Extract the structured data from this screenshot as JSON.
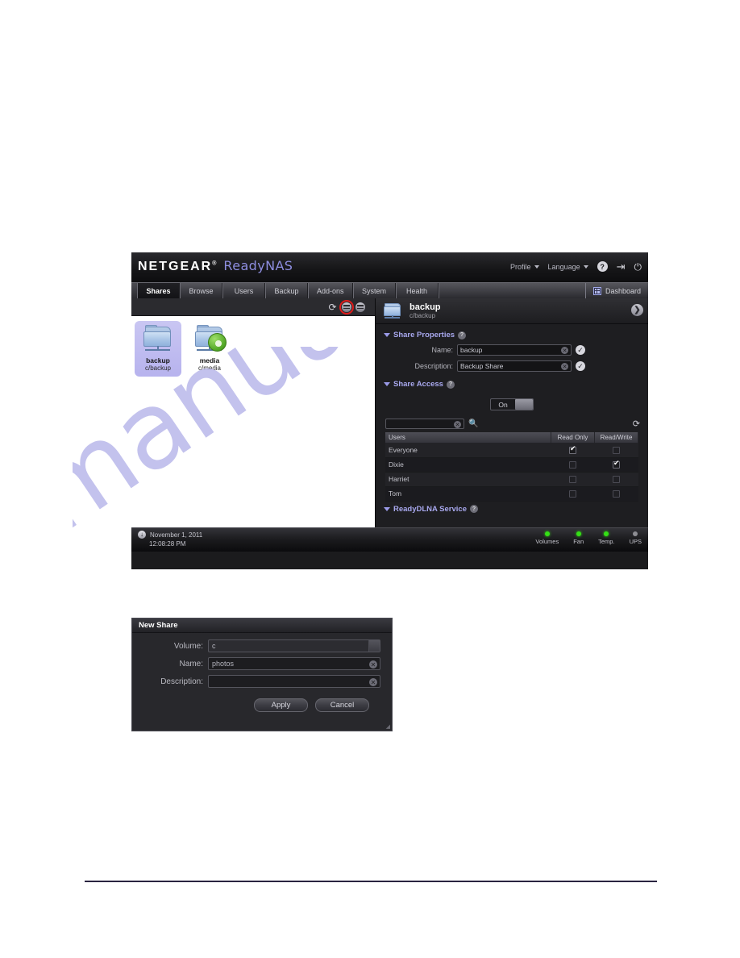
{
  "watermark": {
    "text": "manualshive.com"
  },
  "app": {
    "brand": {
      "netgear": "NETGEAR",
      "tm": "®",
      "product": "ReadyNAS"
    },
    "header_menus": [
      {
        "label": "Profile",
        "icon": "chevron-down-icon"
      },
      {
        "label": "Language",
        "icon": "chevron-down-icon"
      }
    ],
    "header_icons": [
      {
        "name": "help-icon",
        "glyph": "?"
      },
      {
        "name": "logout-icon",
        "glyph": "⇥"
      },
      {
        "name": "power-icon",
        "glyph": "⏻"
      }
    ],
    "tabs": [
      {
        "label": "Shares",
        "active": true
      },
      {
        "label": "Browse",
        "active": false
      },
      {
        "label": "Users",
        "active": false
      },
      {
        "label": "Backup",
        "active": false
      },
      {
        "label": "Add-ons",
        "active": false
      },
      {
        "label": "System",
        "active": false
      },
      {
        "label": "Health",
        "active": false
      }
    ],
    "dashboard_button": {
      "label": "Dashboard",
      "icon": "dashboard-grid-icon"
    },
    "toolbar": {
      "refresh": {
        "name": "refresh-shares-icon",
        "glyph": "⟳"
      },
      "new_share": {
        "name": "new-share-icon",
        "highlighted": true
      },
      "delete_share": {
        "name": "delete-share-icon",
        "highlighted": false
      }
    },
    "shares": [
      {
        "name": "backup",
        "path": "c/backup",
        "selected": true,
        "type": "folder"
      },
      {
        "name": "media",
        "path": "c/media",
        "selected": false,
        "type": "folder-media"
      }
    ],
    "detail": {
      "title": "backup",
      "subtitle": "c/backup",
      "next_glyph": "❯",
      "sections": {
        "share_properties": {
          "title": "Share Properties",
          "fields": [
            {
              "label": "Name:",
              "value": "backup"
            },
            {
              "label": "Description:",
              "value": "Backup Share"
            }
          ]
        },
        "share_access": {
          "title": "Share Access",
          "toggle": {
            "state": "On"
          },
          "search": {
            "value": "",
            "placeholder": ""
          },
          "columns": [
            "Users",
            "Read Only",
            "Read/Write"
          ],
          "rows": [
            {
              "user": "Everyone",
              "read_only": true,
              "read_write": false
            },
            {
              "user": "Dixie",
              "read_only": false,
              "read_write": true
            },
            {
              "user": "Harriet",
              "read_only": false,
              "read_write": false
            },
            {
              "user": "Tom",
              "read_only": false,
              "read_write": false
            }
          ]
        },
        "readydlna": {
          "title": "ReadyDLNA Service"
        }
      }
    },
    "status_bar": {
      "date": "November 1, 2011",
      "time": "12:08:28 PM",
      "indicators": [
        {
          "label": "Volumes",
          "state": "green"
        },
        {
          "label": "Fan",
          "state": "green"
        },
        {
          "label": "Temp.",
          "state": "green"
        },
        {
          "label": "UPS",
          "state": "off"
        }
      ]
    }
  },
  "new_share_dialog": {
    "title": "New Share",
    "fields": [
      {
        "label": "Volume:",
        "value": "c",
        "kind": "select"
      },
      {
        "label": "Name:",
        "value": "photos",
        "kind": "text"
      },
      {
        "label": "Description:",
        "value": "",
        "kind": "text"
      }
    ],
    "buttons": {
      "apply": "Apply",
      "cancel": "Cancel"
    }
  }
}
